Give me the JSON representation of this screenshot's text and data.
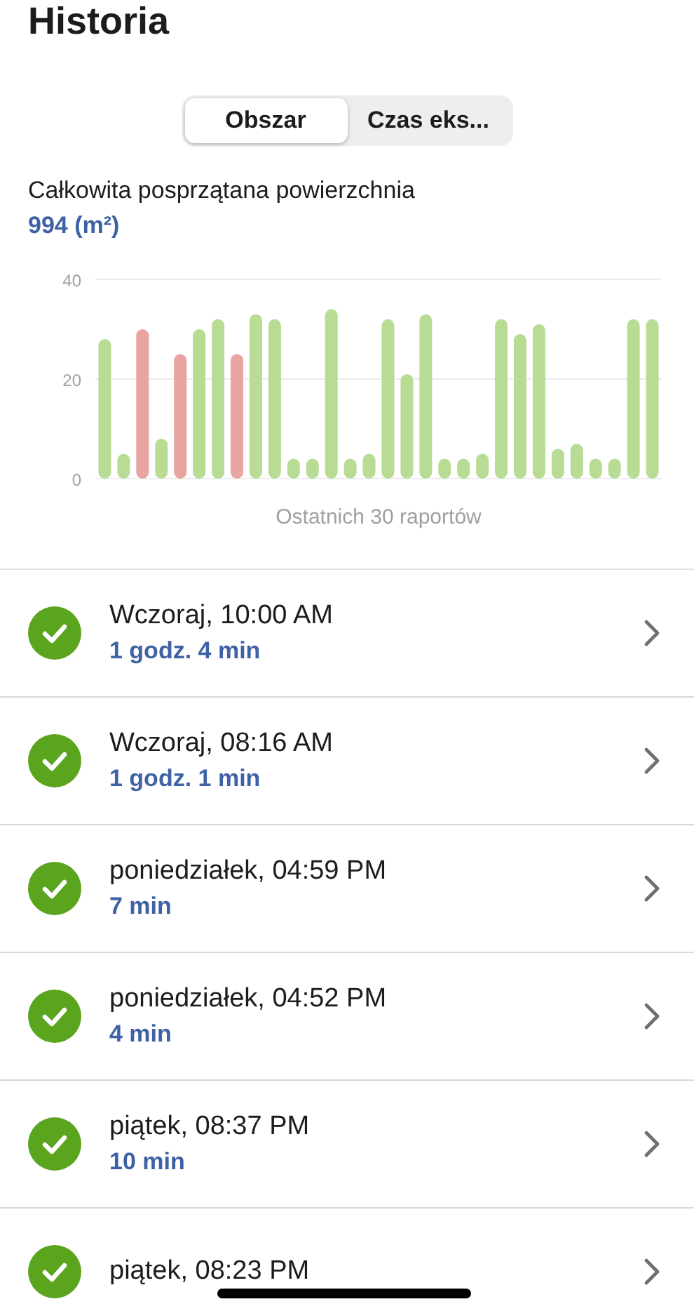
{
  "header": {
    "title": "Historia"
  },
  "segments": [
    {
      "label": "Obszar",
      "selected": true
    },
    {
      "label": "Czas eks...",
      "selected": false
    }
  ],
  "summary": {
    "label": "Całkowita posprzątana powierzchnia",
    "value": "994 (m²)"
  },
  "chart_data": {
    "type": "bar",
    "xlabel": "Ostatnich 30 raportów",
    "stacked": true,
    "ylim": [
      0,
      40
    ],
    "yticks": [
      0,
      20,
      40
    ],
    "series": [
      {
        "color": "#b8dc94",
        "values": [
          28,
          5,
          null,
          8,
          null,
          30,
          32,
          null,
          33,
          32,
          4,
          4,
          34,
          4,
          5,
          32,
          21,
          33,
          4,
          4,
          5,
          32,
          29,
          31,
          6,
          7,
          4,
          4,
          32,
          32
        ]
      },
      {
        "color": "#e8a4a0",
        "values": [
          null,
          null,
          30,
          null,
          25,
          null,
          null,
          25,
          null,
          null,
          null,
          null,
          null,
          null,
          null,
          null,
          null,
          null,
          null,
          null,
          null,
          null,
          null,
          null,
          null,
          null,
          null,
          null,
          null,
          null
        ]
      }
    ]
  },
  "reports": [
    {
      "time": "Wczoraj, 10:00 AM",
      "duration": "1 godz. 4 min",
      "completed": true
    },
    {
      "time": "Wczoraj, 08:16 AM",
      "duration": "1 godz. 1 min",
      "completed": true
    },
    {
      "time": "poniedziałek, 04:59 PM",
      "duration": "7 min",
      "completed": true
    },
    {
      "time": "poniedziałek, 04:52 PM",
      "duration": "4 min",
      "completed": true
    },
    {
      "time": "piątek, 08:37 PM",
      "duration": "10 min",
      "completed": true
    },
    {
      "time": "piątek, 08:23 PM",
      "completed": true
    }
  ]
}
